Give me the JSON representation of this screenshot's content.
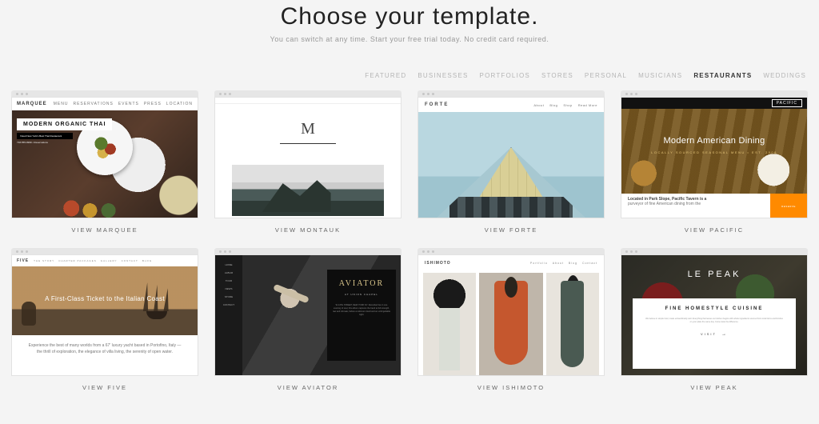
{
  "header": {
    "title": "Choose your template.",
    "subtitle": "You can switch at any time. Start your free trial today. No credit card required."
  },
  "categories": [
    {
      "label": "FEATURED",
      "active": false
    },
    {
      "label": "BUSINESSES",
      "active": false
    },
    {
      "label": "PORTFOLIOS",
      "active": false
    },
    {
      "label": "STORES",
      "active": false
    },
    {
      "label": "PERSONAL",
      "active": false
    },
    {
      "label": "MUSICIANS",
      "active": false
    },
    {
      "label": "RESTAURANTS",
      "active": true
    },
    {
      "label": "WEDDINGS",
      "active": false
    }
  ],
  "templates": {
    "marquee": {
      "caption": "VIEW MARQUEE",
      "brand": "MARQUEE",
      "nav": [
        "MENU",
        "RESERVATIONS",
        "EVENTS",
        "PRESS",
        "LOCATION"
      ],
      "callout": "MODERN ORGANIC THAI",
      "callout_sub": "Voted New York's Best Thai Restaurant",
      "callout_phone": "718-555-9999 • Reservations"
    },
    "montauk": {
      "caption": "VIEW MONTAUK",
      "logo": "M"
    },
    "forte": {
      "caption": "VIEW FORTE",
      "brand": "FORTE",
      "nav": [
        "About",
        "Blog",
        "Shop",
        "Read More"
      ]
    },
    "pacific": {
      "caption": "VIEW PACIFIC",
      "brand": "PACIFIC",
      "headline": "Modern American Dining",
      "subhead": "LOCALLY SOURCED SEASONAL MENU • EST. 2006",
      "strip_bold": "Located in Park Slope, Pacific Tavern is a",
      "strip_line2": "purveyor of fine American dining from the",
      "cta": "RESERVE"
    },
    "five": {
      "caption": "VIEW FIVE",
      "brand": "FIVE",
      "nav": [
        "THE STORY",
        "CHARTER PACKAGES",
        "GALLERY",
        "CONTACT",
        "BLOG"
      ],
      "hero": "A First-Class Ticket to the Italian Coast",
      "desc": "Experience the best of many worlds from a 67' luxury yacht based in Portofino, Italy — the thrill of exploration, the elegance of villa living, the serenity of open water."
    },
    "aviator": {
      "caption": "VIEW AVIATOR",
      "side": [
        "HOME",
        "ALBUM",
        "TOUR",
        "NEWS",
        "STORE",
        "CONTACT"
      ],
      "panel_title": "AVIATOR",
      "panel_sub": "AT UNION CHAPEL",
      "panel_desc": "W 14TH STREET, NEW YORK NY. Recorded live in one evening of soul, this album captures the band at full strength, raw and intimate, before a sold-out crowd and an unforgettable night."
    },
    "ishimoto": {
      "caption": "VIEW ISHIMOTO",
      "brand": "ISHIMOTO",
      "nav": [
        "Portfolio",
        "About",
        "Blog",
        "Contact"
      ]
    },
    "peak": {
      "caption": "VIEW PEAK",
      "title": "LE PEAK",
      "card_title": "FINE HOMESTYLE CUISINE",
      "card_desc": "We believe in simple food, made extraordinarily well. Everything that leaves our kitchen begins with whole ingredients sourced from local farms and finishes on your plate the same day. Come taste the difference.",
      "card_cta": "VISIT"
    }
  }
}
